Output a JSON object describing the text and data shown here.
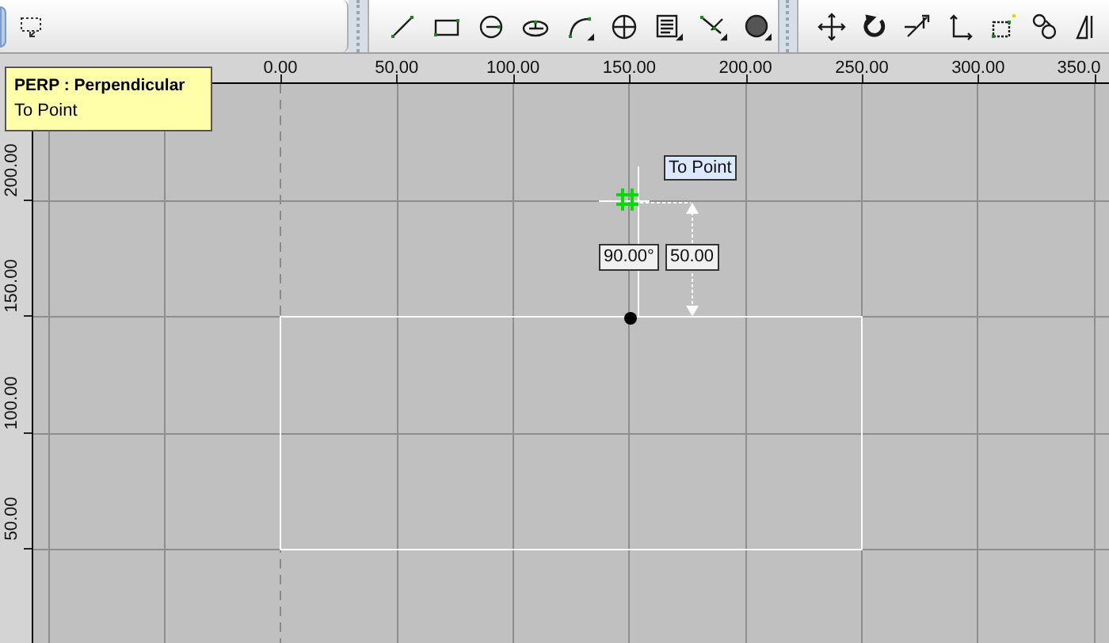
{
  "ruler_top": {
    "labels": [
      "0.00",
      "50.00",
      "100.00",
      "150.00",
      "200.00",
      "250.00",
      "300.00",
      "350.0"
    ]
  },
  "ruler_left": {
    "labels": [
      "200.00",
      "150.00",
      "100.00",
      "50.00"
    ]
  },
  "tooltip": {
    "title": "PERP : Perpendicular",
    "subtitle": "To Point"
  },
  "canvas": {
    "snap_label": "To Point",
    "angle_label": "90.00°",
    "distance_label": "50.00"
  }
}
